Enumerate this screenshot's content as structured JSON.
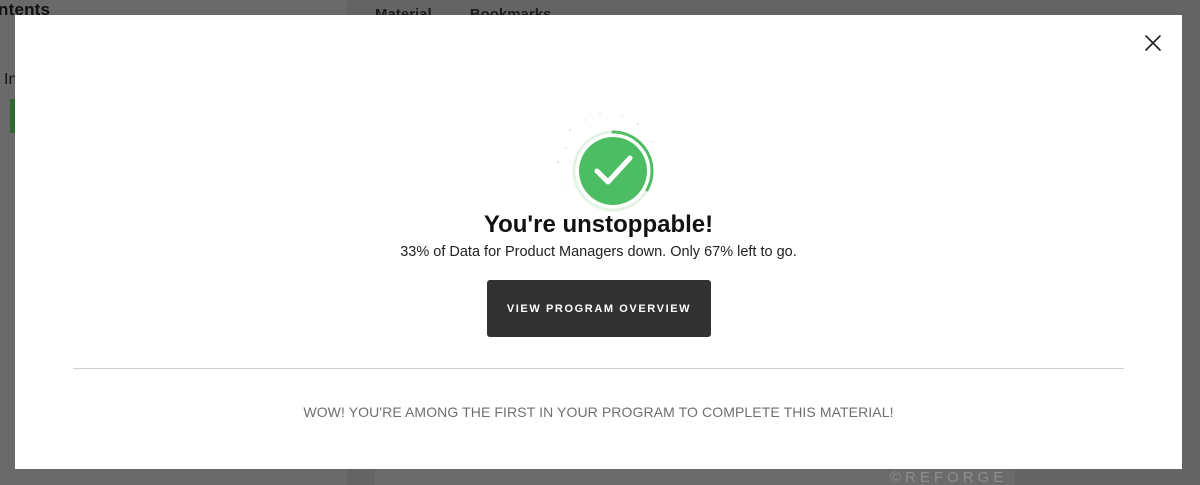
{
  "background": {
    "sidebar_title": "ntents",
    "sidebar_item": "In",
    "tabs": [
      "Material",
      "Bookmarks"
    ],
    "watermark": "©REFORGE"
  },
  "modal": {
    "headline": "You're unstoppable!",
    "subline": "33% of Data for Product Managers down. Only 67% left to go.",
    "progress_percent": 33,
    "cta_label": "VIEW PROGRAM OVERVIEW",
    "footer_message": "WOW! YOU'RE AMONG THE FIRST IN YOUR PROGRAM TO COMPLETE THIS MATERIAL!",
    "close_icon": "close-icon",
    "badge_icon": "checkmark-icon",
    "colors": {
      "accent_green": "#4dbd63",
      "button_bg": "#323232"
    }
  }
}
